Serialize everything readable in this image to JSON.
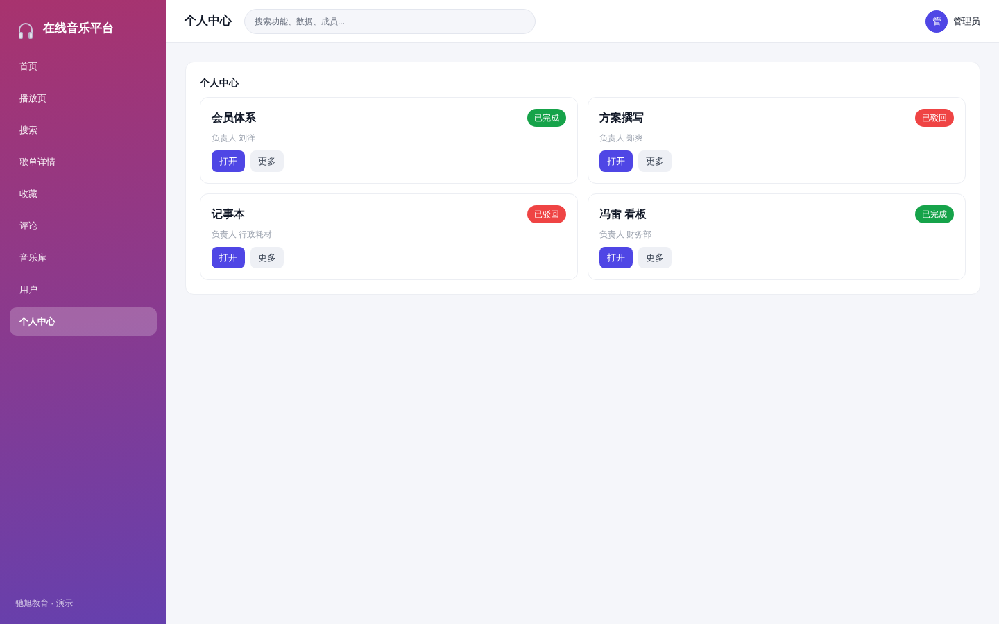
{
  "sidebar": {
    "logo": "在线音乐平台",
    "items": [
      {
        "label": "首页",
        "selected": false
      },
      {
        "label": "播放页",
        "selected": false
      },
      {
        "label": "搜索",
        "selected": false
      },
      {
        "label": "歌单详情",
        "selected": false
      },
      {
        "label": "收藏",
        "selected": false
      },
      {
        "label": "评论",
        "selected": false
      },
      {
        "label": "音乐库",
        "selected": false
      },
      {
        "label": "用户",
        "selected": false
      },
      {
        "label": "个人中心",
        "selected": true
      }
    ],
    "footer": "驰旭教育 · 演示"
  },
  "header": {
    "title": "个人中心",
    "search": {
      "placeholder": "搜索功能、数据、成员..."
    },
    "user": {
      "avatar": "管",
      "name": "管理员"
    }
  },
  "panel": {
    "title": "个人中心",
    "cards": [
      {
        "title": "会员体系",
        "status": {
          "label": "已完成",
          "color": "#16a34a"
        },
        "owner": "负责人 刘洋",
        "buttons": [
          {
            "label": "打开",
            "kind": "primary"
          },
          {
            "label": "更多",
            "kind": "secondary"
          }
        ]
      },
      {
        "title": "方案撰写",
        "status": {
          "label": "已驳回",
          "color": "#ef4444"
        },
        "owner": "负责人 郑爽",
        "buttons": [
          {
            "label": "打开",
            "kind": "primary"
          },
          {
            "label": "更多",
            "kind": "secondary"
          }
        ]
      },
      {
        "title": "记事本",
        "status": {
          "label": "已驳回",
          "color": "#ef4444"
        },
        "owner": "负责人 行政耗材",
        "buttons": [
          {
            "label": "打开",
            "kind": "primary"
          },
          {
            "label": "更多",
            "kind": "secondary"
          }
        ]
      },
      {
        "title": "冯雷 看板",
        "status": {
          "label": "已完成",
          "color": "#16a34a"
        },
        "owner": "负责人 财务部",
        "buttons": [
          {
            "label": "打开",
            "kind": "primary"
          },
          {
            "label": "更多",
            "kind": "secondary"
          }
        ]
      }
    ]
  }
}
